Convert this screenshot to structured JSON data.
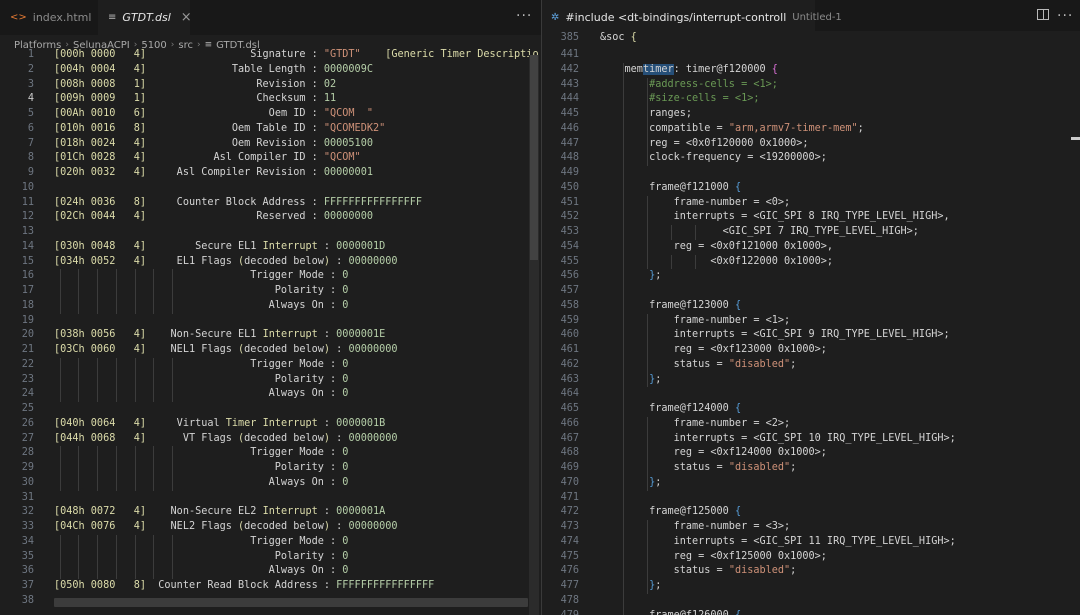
{
  "left_pane": {
    "tabs": [
      {
        "icon": "html-file-icon",
        "label": "index.html",
        "active": false
      },
      {
        "icon": "dsl-file-icon",
        "label": "GTDT.dsl",
        "active": true
      }
    ],
    "more_label": "···",
    "breadcrumb": [
      "Platforms",
      "SelunaACPI",
      "5100",
      "src",
      "GTDT.dsl"
    ],
    "current_line": "4",
    "lines": [
      {
        "n": "1",
        "segs": [
          [
            "[000h 0000   4]",
            "c-yellow"
          ],
          [
            "                 Signature : ",
            "c-text"
          ],
          [
            "\"GTDT\"",
            "c-str"
          ],
          [
            "    [Generic ",
            "c-yellow"
          ],
          [
            "Timer",
            "c-yellow"
          ],
          [
            " Descriptio",
            "c-yellow"
          ]
        ]
      },
      {
        "n": "2",
        "segs": [
          [
            "[004h 0004   4]",
            "c-yellow"
          ],
          [
            "              Table Length : ",
            "c-text"
          ],
          [
            "0000009C",
            "c-num"
          ]
        ]
      },
      {
        "n": "3",
        "segs": [
          [
            "[008h 0008   1]",
            "c-yellow"
          ],
          [
            "                  Revision : ",
            "c-text"
          ],
          [
            "02",
            "c-num"
          ]
        ]
      },
      {
        "n": "4",
        "segs": [
          [
            "[009h 0009   1]",
            "c-yellow"
          ],
          [
            "                  Checksum : ",
            "c-text"
          ],
          [
            "11",
            "c-num"
          ]
        ]
      },
      {
        "n": "5",
        "segs": [
          [
            "[00Ah 0010   6]",
            "c-yellow"
          ],
          [
            "                    Oem ID : ",
            "c-text"
          ],
          [
            "\"QCOM  \"",
            "c-str"
          ]
        ]
      },
      {
        "n": "6",
        "segs": [
          [
            "[010h 0016   8]",
            "c-yellow"
          ],
          [
            "              Oem Table ID : ",
            "c-text"
          ],
          [
            "\"QCOMEDK2\"",
            "c-str"
          ]
        ]
      },
      {
        "n": "7",
        "segs": [
          [
            "[018h 0024   4]",
            "c-yellow"
          ],
          [
            "              Oem Revision : ",
            "c-text"
          ],
          [
            "00005100",
            "c-num"
          ]
        ]
      },
      {
        "n": "8",
        "segs": [
          [
            "[01Ch 0028   4]",
            "c-yellow"
          ],
          [
            "           Asl Compiler ID : ",
            "c-text"
          ],
          [
            "\"QCOM\"",
            "c-str"
          ]
        ]
      },
      {
        "n": "9",
        "segs": [
          [
            "[020h 0032   4]",
            "c-yellow"
          ],
          [
            "     Asl Compiler Revision : ",
            "c-text"
          ],
          [
            "00000001",
            "c-num"
          ]
        ]
      },
      {
        "n": "10",
        "segs": []
      },
      {
        "n": "11",
        "segs": [
          [
            "[024h 0036   8]",
            "c-yellow"
          ],
          [
            "     Counter Block Address : ",
            "c-text"
          ],
          [
            "FFFFFFFFFFFFFFFF",
            "c-num"
          ]
        ]
      },
      {
        "n": "12",
        "segs": [
          [
            "[02Ch 0044   4]",
            "c-yellow"
          ],
          [
            "                  Reserved : ",
            "c-text"
          ],
          [
            "00000000",
            "c-num"
          ]
        ]
      },
      {
        "n": "13",
        "segs": []
      },
      {
        "n": "14",
        "segs": [
          [
            "[030h 0048   4]",
            "c-yellow"
          ],
          [
            "        Secure EL1 ",
            "c-text"
          ],
          [
            "Interrupt",
            "c-yellow"
          ],
          [
            " : ",
            "c-text"
          ],
          [
            "0000001D",
            "c-num"
          ]
        ]
      },
      {
        "n": "15",
        "segs": [
          [
            "[034h 0052   4]",
            "c-yellow"
          ],
          [
            "     EL1 Flags ",
            "c-text"
          ],
          [
            "(",
            "c-yellow"
          ],
          [
            "decoded below",
            "c-text"
          ],
          [
            ")",
            "c-yellow"
          ],
          [
            " : ",
            "c-text"
          ],
          [
            "00000000",
            "c-num"
          ]
        ]
      },
      {
        "n": "16",
        "segs": [
          [
            "                                Trigger Mode : ",
            "c-text"
          ],
          [
            "0",
            "c-num"
          ]
        ]
      },
      {
        "n": "17",
        "segs": [
          [
            "                                    Polarity : ",
            "c-text"
          ],
          [
            "0",
            "c-num"
          ]
        ]
      },
      {
        "n": "18",
        "segs": [
          [
            "                                   Always On : ",
            "c-text"
          ],
          [
            "0",
            "c-num"
          ]
        ]
      },
      {
        "n": "19",
        "segs": []
      },
      {
        "n": "20",
        "segs": [
          [
            "[038h 0056   4]",
            "c-yellow"
          ],
          [
            "    Non-Secure EL1 ",
            "c-text"
          ],
          [
            "Interrupt",
            "c-yellow"
          ],
          [
            " : ",
            "c-text"
          ],
          [
            "0000001E",
            "c-num"
          ]
        ]
      },
      {
        "n": "21",
        "segs": [
          [
            "[03Ch 0060   4]",
            "c-yellow"
          ],
          [
            "    NEL1 Flags ",
            "c-text"
          ],
          [
            "(",
            "c-yellow"
          ],
          [
            "decoded below",
            "c-text"
          ],
          [
            ")",
            "c-yellow"
          ],
          [
            " : ",
            "c-text"
          ],
          [
            "00000000",
            "c-num"
          ]
        ]
      },
      {
        "n": "22",
        "segs": [
          [
            "                                Trigger Mode : ",
            "c-text"
          ],
          [
            "0",
            "c-num"
          ]
        ]
      },
      {
        "n": "23",
        "segs": [
          [
            "                                    Polarity : ",
            "c-text"
          ],
          [
            "0",
            "c-num"
          ]
        ]
      },
      {
        "n": "24",
        "segs": [
          [
            "                                   Always On : ",
            "c-text"
          ],
          [
            "0",
            "c-num"
          ]
        ]
      },
      {
        "n": "25",
        "segs": []
      },
      {
        "n": "26",
        "segs": [
          [
            "[040h 0064   4]",
            "c-yellow"
          ],
          [
            "     Virtual ",
            "c-text"
          ],
          [
            "Timer",
            "c-yellow"
          ],
          [
            " ",
            "c-text"
          ],
          [
            "Interrupt",
            "c-yellow"
          ],
          [
            " : ",
            "c-text"
          ],
          [
            "0000001B",
            "c-num"
          ]
        ]
      },
      {
        "n": "27",
        "segs": [
          [
            "[044h 0068   4]",
            "c-yellow"
          ],
          [
            "      VT Flags ",
            "c-text"
          ],
          [
            "(",
            "c-yellow"
          ],
          [
            "decoded below",
            "c-text"
          ],
          [
            ")",
            "c-yellow"
          ],
          [
            " : ",
            "c-text"
          ],
          [
            "00000000",
            "c-num"
          ]
        ]
      },
      {
        "n": "28",
        "segs": [
          [
            "                                Trigger Mode : ",
            "c-text"
          ],
          [
            "0",
            "c-num"
          ]
        ]
      },
      {
        "n": "29",
        "segs": [
          [
            "                                    Polarity : ",
            "c-text"
          ],
          [
            "0",
            "c-num"
          ]
        ]
      },
      {
        "n": "30",
        "segs": [
          [
            "                                   Always On : ",
            "c-text"
          ],
          [
            "0",
            "c-num"
          ]
        ]
      },
      {
        "n": "31",
        "segs": []
      },
      {
        "n": "32",
        "segs": [
          [
            "[048h 0072   4]",
            "c-yellow"
          ],
          [
            "    Non-Secure EL2 ",
            "c-text"
          ],
          [
            "Interrupt",
            "c-yellow"
          ],
          [
            " : ",
            "c-text"
          ],
          [
            "0000001A",
            "c-num"
          ]
        ]
      },
      {
        "n": "33",
        "segs": [
          [
            "[04Ch 0076   4]",
            "c-yellow"
          ],
          [
            "    NEL2 Flags ",
            "c-text"
          ],
          [
            "(",
            "c-yellow"
          ],
          [
            "decoded below",
            "c-text"
          ],
          [
            ")",
            "c-yellow"
          ],
          [
            " : ",
            "c-text"
          ],
          [
            "00000000",
            "c-num"
          ]
        ]
      },
      {
        "n": "34",
        "segs": [
          [
            "                                Trigger Mode : ",
            "c-text"
          ],
          [
            "0",
            "c-num"
          ]
        ]
      },
      {
        "n": "35",
        "segs": [
          [
            "                                    Polarity : ",
            "c-text"
          ],
          [
            "0",
            "c-num"
          ]
        ]
      },
      {
        "n": "36",
        "segs": [
          [
            "                                   Always On : ",
            "c-text"
          ],
          [
            "0",
            "c-num"
          ]
        ]
      },
      {
        "n": "37",
        "segs": [
          [
            "[050h 0080   8]",
            "c-yellow"
          ],
          [
            "  Counter Read Block Address : ",
            "c-text"
          ],
          [
            "FFFFFFFFFFFFFFFF",
            "c-num"
          ]
        ]
      },
      {
        "n": "38",
        "segs": []
      }
    ]
  },
  "right_pane": {
    "tab": {
      "icon": "device-tree-file-icon",
      "label": "#include <dt-bindings/interrupt-controll",
      "suffix": "Untitled-1",
      "dirty": true
    },
    "more_label": "···",
    "lines": [
      {
        "n": "441",
        "segs": []
      },
      {
        "n": "442",
        "segs": [
          [
            "    mem",
            "c-text"
          ],
          [
            "timer",
            "c-text"
          ],
          [
            ": timer@f120000 ",
            "c-text"
          ],
          [
            "{",
            "c-brace2"
          ]
        ]
      },
      {
        "n": "443",
        "segs": [
          [
            "        #address-cells = <1>;",
            "c-comment"
          ]
        ]
      },
      {
        "n": "444",
        "segs": [
          [
            "        #size-cells = <1>;",
            "c-comment"
          ]
        ]
      },
      {
        "n": "445",
        "segs": [
          [
            "        ranges;",
            "c-text"
          ]
        ]
      },
      {
        "n": "446",
        "segs": [
          [
            "        compatible = ",
            "c-text"
          ],
          [
            "\"arm,armv7-timer-mem\"",
            "c-str"
          ],
          [
            ";",
            "c-text"
          ]
        ]
      },
      {
        "n": "447",
        "segs": [
          [
            "        reg = <0x0f120000 0x1000>;",
            "c-text"
          ]
        ]
      },
      {
        "n": "448",
        "segs": [
          [
            "        clock-frequency = <19200000>;",
            "c-text"
          ]
        ]
      },
      {
        "n": "449",
        "segs": []
      },
      {
        "n": "450",
        "segs": [
          [
            "        frame@f121000 ",
            "c-text"
          ],
          [
            "{",
            "c-brace"
          ]
        ]
      },
      {
        "n": "451",
        "segs": [
          [
            "            frame-number = <0>;",
            "c-text"
          ]
        ]
      },
      {
        "n": "452",
        "segs": [
          [
            "            interrupts = <GIC_SPI 8 IRQ_TYPE_LEVEL_HIGH>,",
            "c-text"
          ]
        ]
      },
      {
        "n": "453",
        "segs": [
          [
            "                    <GIC_SPI 7 IRQ_TYPE_LEVEL_HIGH>;",
            "c-text"
          ]
        ]
      },
      {
        "n": "454",
        "segs": [
          [
            "            reg = <0x0f121000 0x1000>,",
            "c-text"
          ]
        ]
      },
      {
        "n": "455",
        "segs": [
          [
            "                  <0x0f122000 0x1000>;",
            "c-text"
          ]
        ]
      },
      {
        "n": "456",
        "segs": [
          [
            "        ",
            "c-text"
          ],
          [
            "}",
            "c-brace"
          ],
          [
            ";",
            "c-text"
          ]
        ]
      },
      {
        "n": "457",
        "segs": []
      },
      {
        "n": "458",
        "segs": [
          [
            "        frame@f123000 ",
            "c-text"
          ],
          [
            "{",
            "c-brace"
          ]
        ]
      },
      {
        "n": "459",
        "segs": [
          [
            "            frame-number = <1>;",
            "c-text"
          ]
        ]
      },
      {
        "n": "460",
        "segs": [
          [
            "            interrupts = <GIC_SPI 9 IRQ_TYPE_LEVEL_HIGH>;",
            "c-text"
          ]
        ]
      },
      {
        "n": "461",
        "segs": [
          [
            "            reg = <0xf123000 0x1000>;",
            "c-text"
          ]
        ]
      },
      {
        "n": "462",
        "segs": [
          [
            "            status = ",
            "c-text"
          ],
          [
            "\"disabled\"",
            "c-str"
          ],
          [
            ";",
            "c-text"
          ]
        ]
      },
      {
        "n": "463",
        "segs": [
          [
            "        ",
            "c-text"
          ],
          [
            "}",
            "c-brace"
          ],
          [
            ";",
            "c-text"
          ]
        ]
      },
      {
        "n": "464",
        "segs": []
      },
      {
        "n": "465",
        "segs": [
          [
            "        frame@f124000 ",
            "c-text"
          ],
          [
            "{",
            "c-brace"
          ]
        ]
      },
      {
        "n": "466",
        "segs": [
          [
            "            frame-number = <2>;",
            "c-text"
          ]
        ]
      },
      {
        "n": "467",
        "segs": [
          [
            "            interrupts = <GIC_SPI 10 IRQ_TYPE_LEVEL_HIGH>;",
            "c-text"
          ]
        ]
      },
      {
        "n": "468",
        "segs": [
          [
            "            reg = <0xf124000 0x1000>;",
            "c-text"
          ]
        ]
      },
      {
        "n": "469",
        "segs": [
          [
            "            status = ",
            "c-text"
          ],
          [
            "\"disabled\"",
            "c-str"
          ],
          [
            ";",
            "c-text"
          ]
        ]
      },
      {
        "n": "470",
        "segs": [
          [
            "        ",
            "c-text"
          ],
          [
            "}",
            "c-brace"
          ],
          [
            ";",
            "c-text"
          ]
        ]
      },
      {
        "n": "471",
        "segs": []
      },
      {
        "n": "472",
        "segs": [
          [
            "        frame@f125000 ",
            "c-text"
          ],
          [
            "{",
            "c-brace"
          ]
        ]
      },
      {
        "n": "473",
        "segs": [
          [
            "            frame-number = <3>;",
            "c-text"
          ]
        ]
      },
      {
        "n": "474",
        "segs": [
          [
            "            interrupts = <GIC_SPI 11 IRQ_TYPE_LEVEL_HIGH>;",
            "c-text"
          ]
        ]
      },
      {
        "n": "475",
        "segs": [
          [
            "            reg = <0xf125000 0x1000>;",
            "c-text"
          ]
        ]
      },
      {
        "n": "476",
        "segs": [
          [
            "            status = ",
            "c-text"
          ],
          [
            "\"disabled\"",
            "c-str"
          ],
          [
            ";",
            "c-text"
          ]
        ]
      },
      {
        "n": "477",
        "segs": [
          [
            "        ",
            "c-text"
          ],
          [
            "}",
            "c-brace"
          ],
          [
            ";",
            "c-text"
          ]
        ]
      },
      {
        "n": "478",
        "segs": []
      },
      {
        "n": "479",
        "segs": [
          [
            "        frame@f126000 ",
            "c-text"
          ],
          [
            "{",
            "c-brace"
          ]
        ]
      }
    ],
    "sticky": [
      {
        "n": "385",
        "segs": [
          [
            "&soc ",
            "c-text"
          ],
          [
            "{",
            "c-yellow"
          ]
        ]
      }
    ]
  }
}
